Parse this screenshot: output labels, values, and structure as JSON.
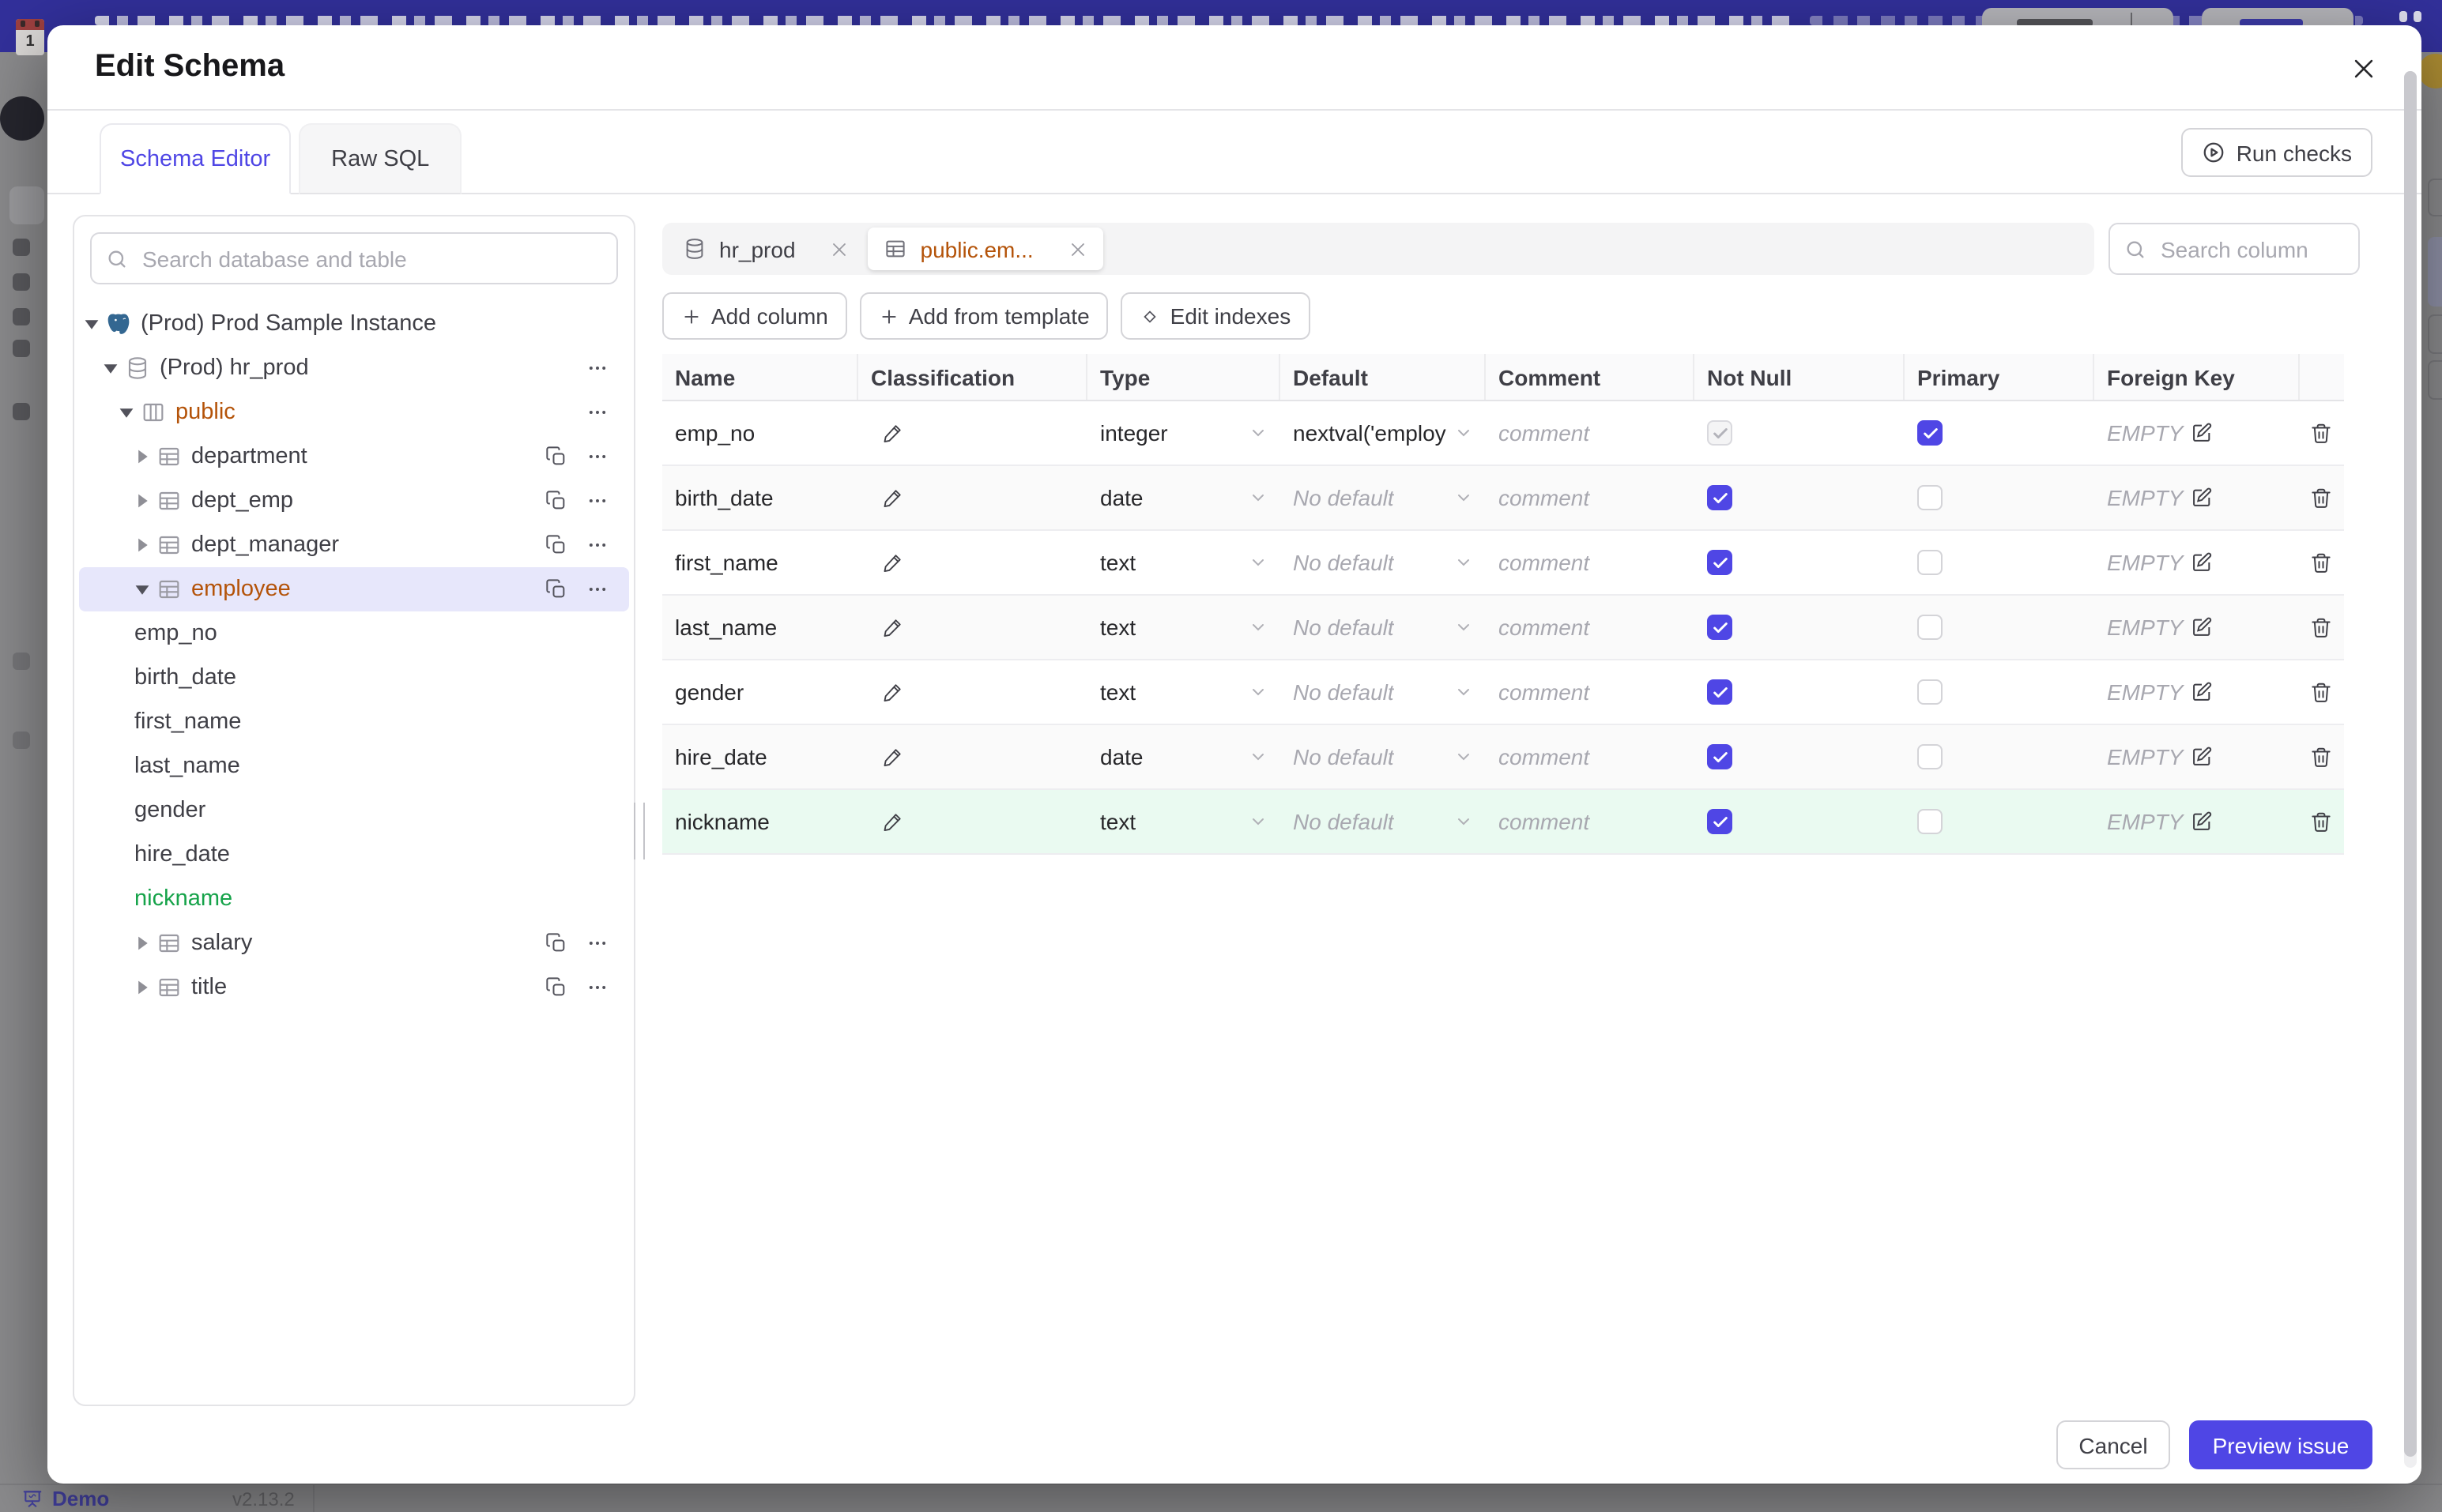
{
  "colors": {
    "accent": "#4f46e5",
    "amber": "#b45309",
    "green": "#16a34a",
    "topbar": "#32309b",
    "selected_row": "#e7e7fb",
    "new_row": "#eafaf1"
  },
  "backdrop": {
    "calendar_day": "1",
    "demo_label": "Demo",
    "version": "v2.13.2"
  },
  "modal": {
    "title": "Edit Schema",
    "run_checks_label": "Run checks",
    "tabs": [
      {
        "label": "Schema Editor",
        "active": true
      },
      {
        "label": "Raw SQL",
        "active": false
      }
    ],
    "sidebar": {
      "search_placeholder": "Search database and table",
      "tree": [
        {
          "label": "(Prod) Prod Sample Instance",
          "level": 0,
          "kind": "instance",
          "icon": "postgresql",
          "expanded": true
        },
        {
          "label": "(Prod) hr_prod",
          "level": 1,
          "kind": "database",
          "icon": "database",
          "expanded": true,
          "menu": true
        },
        {
          "label": "public",
          "level": 2,
          "kind": "schema",
          "icon": "schema",
          "expanded": true,
          "menu": true,
          "highlight": "amber"
        },
        {
          "label": "department",
          "level": 3,
          "kind": "table",
          "icon": "table",
          "expanded": false,
          "copy": true,
          "menu": true
        },
        {
          "label": "dept_emp",
          "level": 3,
          "kind": "table",
          "icon": "table",
          "expanded": false,
          "copy": true,
          "menu": true
        },
        {
          "label": "dept_manager",
          "level": 3,
          "kind": "table",
          "icon": "table",
          "expanded": false,
          "copy": true,
          "menu": true
        },
        {
          "label": "employee",
          "level": 3,
          "kind": "table",
          "icon": "table",
          "expanded": true,
          "copy": true,
          "menu": true,
          "highlight": "amber",
          "selected": true
        },
        {
          "label": "emp_no",
          "kind": "column"
        },
        {
          "label": "birth_date",
          "kind": "column"
        },
        {
          "label": "first_name",
          "kind": "column"
        },
        {
          "label": "last_name",
          "kind": "column"
        },
        {
          "label": "gender",
          "kind": "column"
        },
        {
          "label": "hire_date",
          "kind": "column"
        },
        {
          "label": "nickname",
          "kind": "column",
          "highlight": "green"
        },
        {
          "label": "salary",
          "level": 3,
          "kind": "table",
          "icon": "table",
          "expanded": false,
          "copy": true,
          "menu": true
        },
        {
          "label": "title",
          "level": 3,
          "kind": "table",
          "icon": "table",
          "expanded": false,
          "copy": true,
          "menu": true
        }
      ]
    },
    "editor": {
      "chips": [
        {
          "label": "hr_prod",
          "icon": "database",
          "active": false
        },
        {
          "label": "public.em...",
          "icon": "table",
          "active": true
        }
      ],
      "column_search_placeholder": "Search column",
      "actions": [
        {
          "icon": "plus",
          "label": "Add column"
        },
        {
          "icon": "plus",
          "label": "Add from template"
        },
        {
          "icon": "diamond",
          "label": "Edit indexes"
        }
      ],
      "table": {
        "headers": [
          "Name",
          "Classification",
          "Type",
          "Default",
          "Comment",
          "Not Null",
          "Primary",
          "Foreign Key",
          ""
        ],
        "comment_placeholder": "comment",
        "no_default_label": "No default",
        "foreign_key_empty": "EMPTY",
        "rows": [
          {
            "name": "emp_no",
            "type": "integer",
            "default": "nextval('employ",
            "not_null": "disabled-checked",
            "primary": true,
            "new": false
          },
          {
            "name": "birth_date",
            "type": "date",
            "default": "",
            "not_null": "checked",
            "primary": false,
            "new": false
          },
          {
            "name": "first_name",
            "type": "text",
            "default": "",
            "not_null": "checked",
            "primary": false,
            "new": false
          },
          {
            "name": "last_name",
            "type": "text",
            "default": "",
            "not_null": "checked",
            "primary": false,
            "new": false
          },
          {
            "name": "gender",
            "type": "text",
            "default": "",
            "not_null": "checked",
            "primary": false,
            "new": false
          },
          {
            "name": "hire_date",
            "type": "date",
            "default": "",
            "not_null": "checked",
            "primary": false,
            "new": false
          },
          {
            "name": "nickname",
            "type": "text",
            "default": "",
            "not_null": "checked",
            "primary": false,
            "new": true
          }
        ]
      }
    },
    "footer": {
      "cancel": "Cancel",
      "submit": "Preview issue"
    }
  }
}
